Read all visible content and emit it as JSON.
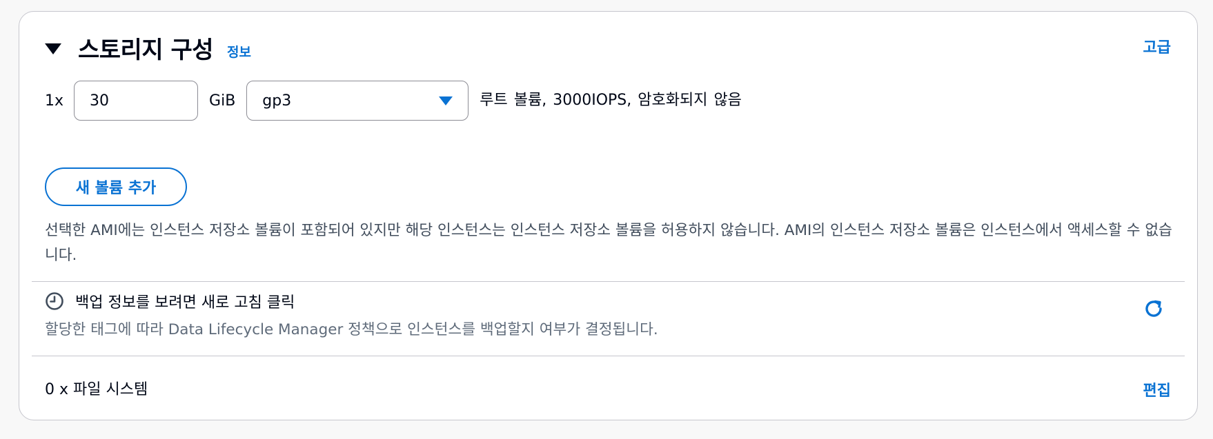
{
  "section": {
    "title": "스토리지 구성",
    "info_label": "정보",
    "advanced_label": "고급"
  },
  "volume": {
    "multiplier": "1x",
    "size_value": "30",
    "unit": "GiB",
    "type_selected": "gp3",
    "description": "루트 볼륨,  3000IOPS,  암호화되지 않음"
  },
  "add_volume_label": "새 볼륨 추가",
  "warning_text": "선택한 AMI에는 인스턴스 저장소 볼륨이 포함되어 있지만 해당 인스턴스는 인스턴스 저장소 볼륨을 허용하지 않습니다. AMI의 인스턴스 저장소 볼륨은 인스턴스에서 액세스할 수 없습니다.",
  "backup": {
    "title": "백업 정보를 보려면 새로 고침 클릭",
    "subtitle": "할당한 태그에 따라 Data Lifecycle Manager 정책으로 인스턴스를 백업할지 여부가 결정됩니다.",
    "icon": "clock-icon",
    "refresh_icon": "refresh-icon"
  },
  "filesystem": {
    "label": "0 x 파일 시스템",
    "edit_label": "편집"
  },
  "colors": {
    "link": "#0972d3",
    "text": "#000716",
    "muted": "#5f6b7a",
    "border": "#c6c6cd"
  }
}
